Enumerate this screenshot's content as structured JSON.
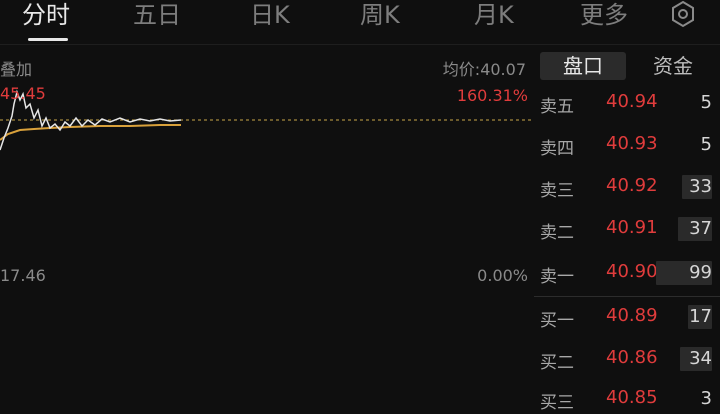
{
  "tabs": [
    {
      "label": "分时",
      "active": true
    },
    {
      "label": "五日",
      "active": false
    },
    {
      "label": "日K",
      "active": false
    },
    {
      "label": "周K",
      "active": false
    },
    {
      "label": "月K",
      "active": false
    },
    {
      "label": "更多",
      "active": false
    }
  ],
  "settings_icon": "settings-hexagon-icon",
  "chart": {
    "overlay_label": "叠加",
    "avg_price_label": "均价:40.07",
    "price_high": "45.45",
    "pct_high": "160.31%",
    "price_low": "17.46",
    "pct_low": "0.00%"
  },
  "side_tabs": [
    {
      "label": "盘口",
      "active": true
    },
    {
      "label": "资金",
      "active": false
    }
  ],
  "order_book": {
    "asks": [
      {
        "label": "卖五",
        "price": "40.94",
        "volume": "5"
      },
      {
        "label": "卖四",
        "price": "40.93",
        "volume": "5"
      },
      {
        "label": "卖三",
        "price": "40.92",
        "volume": "33"
      },
      {
        "label": "卖二",
        "price": "40.91",
        "volume": "37"
      },
      {
        "label": "卖一",
        "price": "40.90",
        "volume": "99"
      }
    ],
    "bids": [
      {
        "label": "买一",
        "price": "40.89",
        "volume": "17"
      },
      {
        "label": "买二",
        "price": "40.86",
        "volume": "34"
      },
      {
        "label": "买三",
        "price": "40.85",
        "volume": "3"
      }
    ]
  },
  "colors": {
    "up_red": "#e03c3c",
    "price_line": "#e6e6e6",
    "avg_line": "#d9a13b",
    "background": "#0f0f0f"
  }
}
